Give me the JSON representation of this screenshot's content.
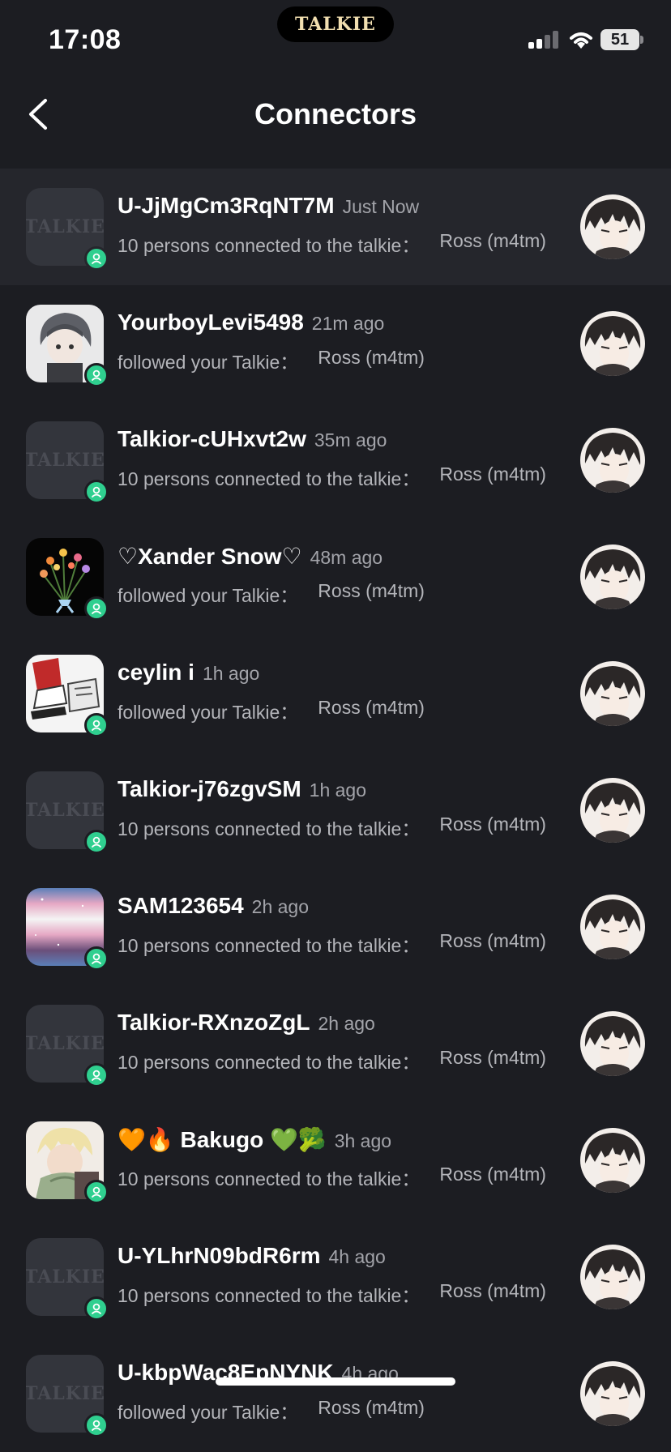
{
  "status_bar": {
    "time": "17:08",
    "battery": "51",
    "island_logo": "TALKIE"
  },
  "header": {
    "title": "Connectors"
  },
  "placeholder_logo": "TALKIE",
  "items": [
    {
      "name": "U-JjMgCm3RqNT7M",
      "time": "Just Now",
      "action": "10 persons connected to the talkie：",
      "target": "Ross (m4tm)",
      "avatar": "placeholder",
      "highlighted": true
    },
    {
      "name": "YourboyLevi5498",
      "time": "21m ago",
      "action": "followed your Talkie：",
      "target": "Ross (m4tm)",
      "avatar": "anime-gray"
    },
    {
      "name": "Talkior-cUHxvt2w",
      "time": "35m ago",
      "action": "10 persons connected to the talkie：",
      "target": "Ross (m4tm)",
      "avatar": "placeholder"
    },
    {
      "name": "♡Xander Snow♡",
      "time": "48m ago",
      "action": "followed your Talkie：",
      "target": "Ross (m4tm)",
      "avatar": "flowers"
    },
    {
      "name": "ceylin i",
      "time": "1h ago",
      "action": "followed your Talkie：",
      "target": "Ross (m4tm)",
      "avatar": "sneakers"
    },
    {
      "name": "Talkior-j76zgvSM",
      "time": "1h ago",
      "action": "10 persons connected to the talkie：",
      "target": "Ross (m4tm)",
      "avatar": "placeholder"
    },
    {
      "name": "SAM123654",
      "time": "2h ago",
      "action": "10 persons connected to the talkie：",
      "target": "Ross (m4tm)",
      "avatar": "galaxy-flag"
    },
    {
      "name": "Talkior-RXnzoZgL",
      "time": "2h ago",
      "action": "10 persons connected to the talkie：",
      "target": "Ross (m4tm)",
      "avatar": "placeholder"
    },
    {
      "name": "🧡🔥 Bakugo 💚🥦",
      "time": "3h ago",
      "action": "10 persons connected to the talkie：",
      "target": "Ross (m4tm)",
      "avatar": "anime-blond"
    },
    {
      "name": "U-YLhrN09bdR6rm",
      "time": "4h ago",
      "action": "10 persons connected to the talkie：",
      "target": "Ross (m4tm)",
      "avatar": "placeholder"
    },
    {
      "name": "U-kbpWac8EpNYNK",
      "time": "4h ago",
      "action": "followed your Talkie：",
      "target": "Ross (m4tm)",
      "avatar": "placeholder"
    }
  ]
}
